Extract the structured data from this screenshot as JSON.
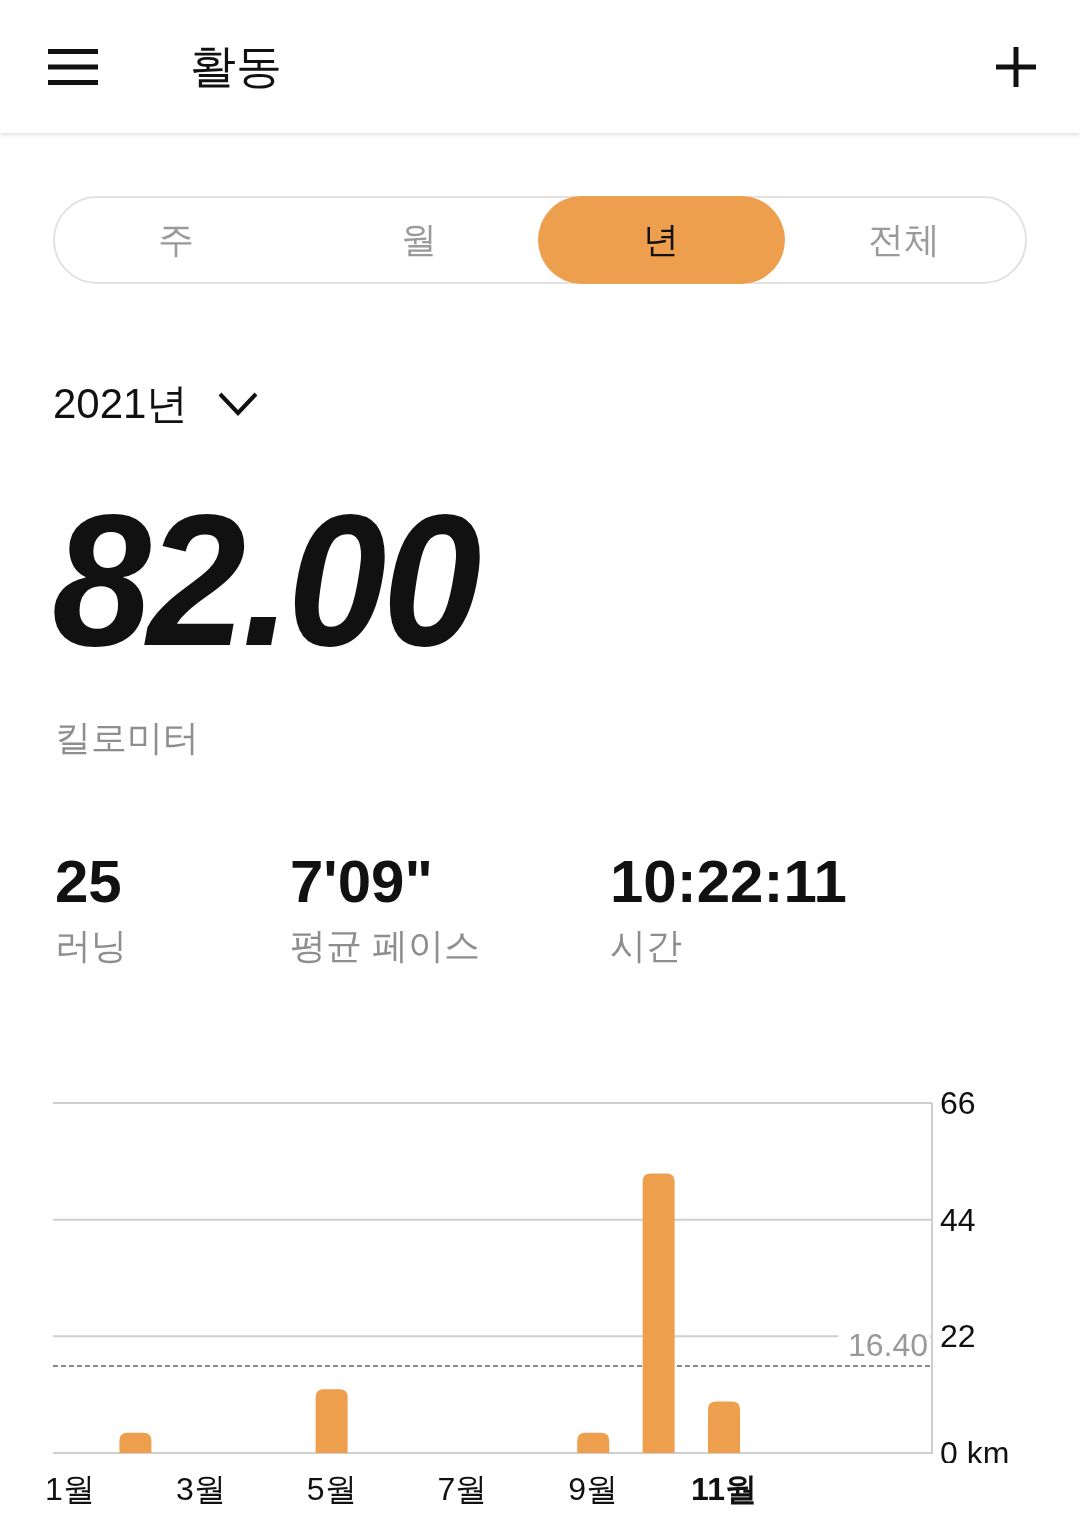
{
  "header": {
    "title": "활동"
  },
  "segments": [
    {
      "label": "주",
      "selected": false
    },
    {
      "label": "월",
      "selected": false
    },
    {
      "label": "년",
      "selected": true
    },
    {
      "label": "전체",
      "selected": false
    }
  ],
  "period": {
    "label": "2021년"
  },
  "total": {
    "value": "82.00",
    "unit": "킬로미터"
  },
  "stats": [
    {
      "value": "25",
      "label": "러닝"
    },
    {
      "value": "7'09\"",
      "label": "평균 페이스"
    },
    {
      "value": "10:22:11",
      "label": "시간"
    }
  ],
  "chart": {
    "chart_data": {
      "type": "bar",
      "x": [
        2,
        5,
        9,
        10,
        11
      ],
      "series": [
        {
          "color": "#ee9f4d",
          "values": [
            3.8,
            12.0,
            3.8,
            52.7,
            9.7
          ]
        }
      ],
      "xlim": [
        0.74,
        14.18
      ],
      "xticks": [
        {
          "value": 1,
          "label": "1월"
        },
        {
          "value": 3,
          "label": "3월"
        },
        {
          "value": 5,
          "label": "5월"
        },
        {
          "value": 7,
          "label": "7월"
        },
        {
          "value": 9,
          "label": "9월"
        },
        {
          "value": 11,
          "label": "**11월**"
        }
      ],
      "ylim": [
        0,
        66
      ],
      "yticks": [
        {
          "value": 0,
          "label": "0 km"
        },
        {
          "value": 22,
          "label": "22"
        },
        {
          "value": 44,
          "label": "44"
        },
        {
          "value": 66,
          "label": "66"
        }
      ],
      "ref_lines": [
        {
          "axis": "y",
          "value": 16.4,
          "label": "16.40"
        }
      ]
    }
  }
}
